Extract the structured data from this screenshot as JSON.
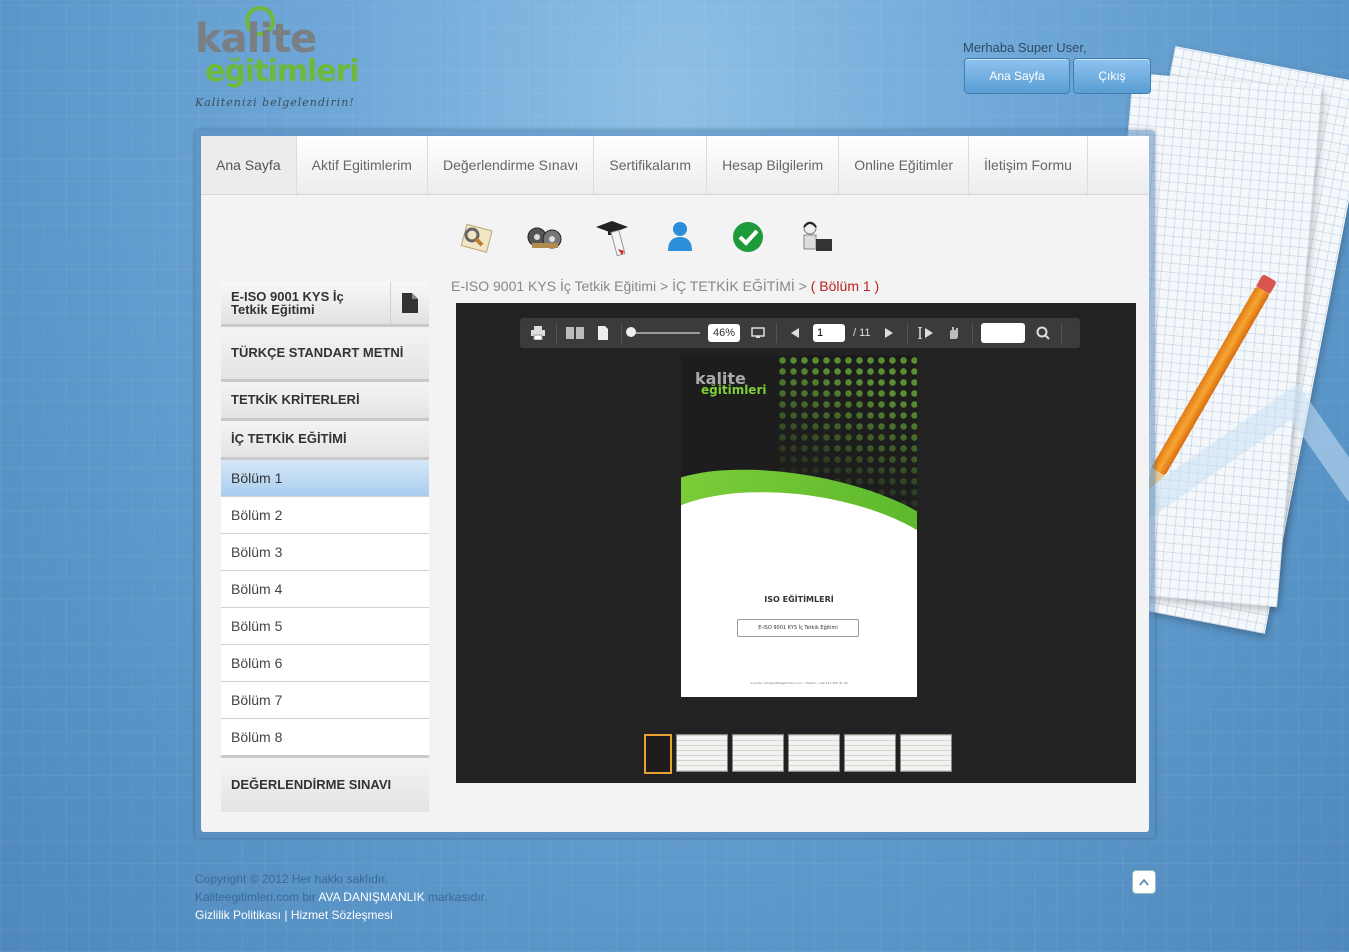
{
  "header": {
    "logo_top": "kalite",
    "logo_bottom": "eğitimleri",
    "slogan": "Kalitenizi belgelendirin!",
    "greeting": "Merhaba Super User,",
    "buttons": {
      "home": "Ana Sayfa",
      "logout": "Çıkış"
    }
  },
  "nav": {
    "tabs": [
      {
        "label": "Ana Sayfa",
        "active": true
      },
      {
        "label": "Aktif Egitimlerim"
      },
      {
        "label": "Değerlendirme Sınavı"
      },
      {
        "label": "Sertifikalarım"
      },
      {
        "label": "Hesap Bilgilerim"
      },
      {
        "label": "Online Eğitimler"
      },
      {
        "label": "İletişim Formu"
      }
    ]
  },
  "icons": [
    "search-document-icon",
    "film-reels-icon",
    "graduation-diploma-icon",
    "user-icon",
    "checkmark-icon",
    "support-agent-icon"
  ],
  "sidebar": {
    "header": "E-ISO 9001 KYS İç Tetkik Eğitimi",
    "categories": [
      "TÜRKÇE STANDART METNİ",
      "TETKİK KRİTERLERİ",
      "İÇ TETKİK EĞİTİMİ",
      "DEĞERLENDİRME SINAVI"
    ],
    "items": [
      "Bölüm 1",
      "Bölüm 2",
      "Bölüm 3",
      "Bölüm 4",
      "Bölüm 5",
      "Bölüm 6",
      "Bölüm 7",
      "Bölüm 8"
    ],
    "active_item": "Bölüm 1"
  },
  "breadcrumb": {
    "part1": "E-ISO 9001 KYS İç Tetkik Eğitimi",
    "sep": " > ",
    "part2": "İÇ TETKİK EĞİTİMİ",
    "current": "( Bölüm 1 )"
  },
  "viewer": {
    "zoom": "46%",
    "page": "1",
    "total": "/ 11",
    "document": {
      "logo_top": "kalite",
      "logo_bottom": "eğitimleri",
      "title": "ISO EĞİTİMLERİ",
      "subtitle": "E-ISO 9001 KYS İç Tetkik Eğitimi",
      "footer": "e-posta: info@kaliteegitimleri.com • Telefon: +90 216 365 41 46"
    },
    "thumbnail_count": 6
  },
  "footer": {
    "copyright": "Copyright © 2012 Her hakkı saklıdır.",
    "brand_pre": "Kaliteegitimleri.com bir",
    "brand": "AVA DANIŞMANLIK",
    "brand_post": "markasıdır.",
    "privacy": "Gizlilik Politikası",
    "divider": "|",
    "terms": "Hizmet Sözleşmesi"
  }
}
